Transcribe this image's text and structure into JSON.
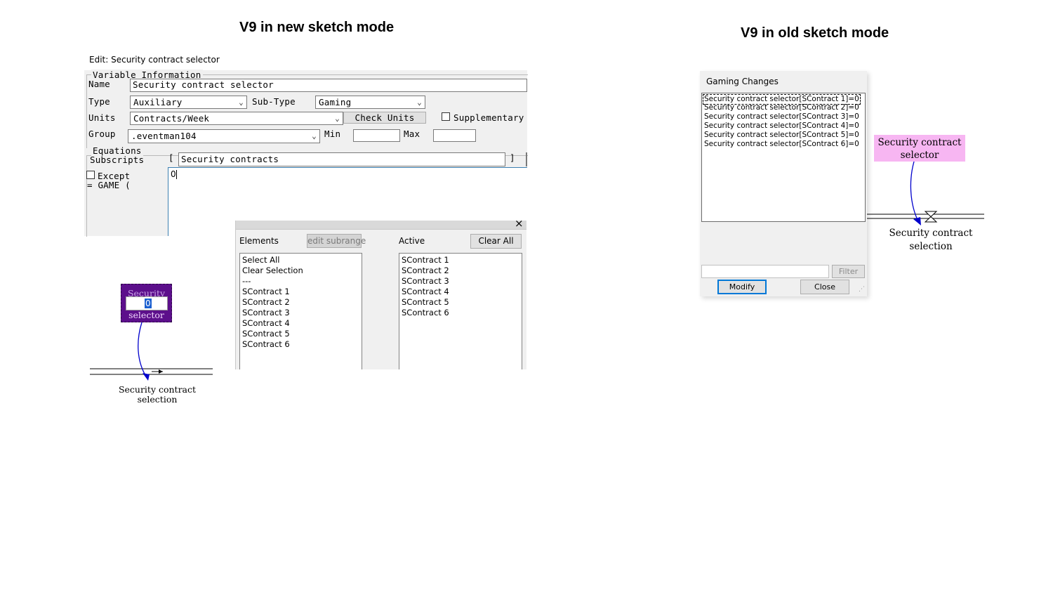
{
  "titles": {
    "new_mode": "V9 in new sketch mode",
    "old_mode": "V9 in old sketch mode"
  },
  "edit_window": {
    "title": "Edit: Security contract selector",
    "variable_info_label": "Variable Information",
    "name_label": "Name",
    "name_value": "Security contract selector",
    "type_label": "Type",
    "type_value": "Auxiliary",
    "subtype_label": "Sub-Type",
    "subtype_value": "Gaming",
    "units_label": "Units",
    "units_value": "Contracts/Week",
    "check_units_label": "Check Units",
    "supplementary_label": "Supplementary",
    "group_label": "Group",
    "group_value": ".eventman104",
    "min_label": "Min",
    "min_value": "",
    "max_label": "Max",
    "max_value": "",
    "equations_label": "Equations",
    "subscripts_label": "Subscripts",
    "bracket_open": "[",
    "bracket_close": "]",
    "subscripts_value": "Security contracts",
    "except_label": "Except",
    "game_label": "= GAME (",
    "equation_value": "0"
  },
  "subscript_picker": {
    "close_glyph": "×",
    "elements_label": "Elements",
    "edit_subrange_label": "edit subrange",
    "active_label": "Active",
    "clear_all_label": "Clear All",
    "elements": [
      "Select All",
      "Clear Selection",
      "---",
      "SContract 1",
      "SContract 2",
      "SContract 3",
      "SContract 4",
      "SContract 5",
      "SContract 6"
    ],
    "active": [
      "SContract 1",
      "SContract 2",
      "SContract 3",
      "SContract 4",
      "SContract 5",
      "SContract 6"
    ]
  },
  "new_sketch": {
    "selector_top": "Security",
    "selector_value": "0",
    "selector_bottom": "selector",
    "flow_label_line1": "Security contract",
    "flow_label_line2": "selection"
  },
  "gaming_dialog": {
    "title": "Gaming Changes",
    "items": [
      "Security contract selector[SContract 1]=0",
      "Security contract selector[SContract 2]=0",
      "Security contract selector[SContract 3]=0",
      "Security contract selector[SContract 4]=0",
      "Security contract selector[SContract 5]=0",
      "Security contract selector[SContract 6]=0"
    ],
    "filter_value": "",
    "filter_label": "Filter",
    "modify_label": "Modify",
    "close_label": "Close"
  },
  "old_sketch": {
    "selector_line1": "Security contract",
    "selector_line2": "selector",
    "flow_label_line1": "Security contract",
    "flow_label_line2": "selection"
  },
  "colors": {
    "selector_purple": "#5c0f8b",
    "selector_pink": "#f7b6f2",
    "arrow_blue": "#0000cc",
    "dialog_gray": "#f0f0f0"
  }
}
